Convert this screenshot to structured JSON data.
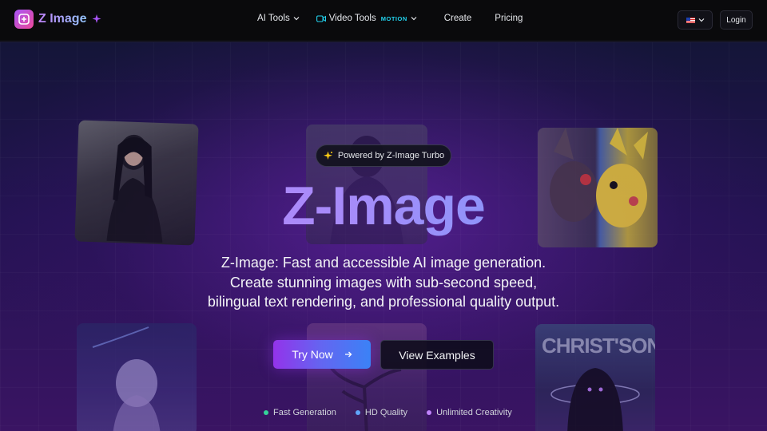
{
  "brand": {
    "name": "Z Image"
  },
  "nav": {
    "ai_tools": "AI Tools",
    "video_tools": "Video Tools",
    "motion_badge": "MOTION",
    "create": "Create",
    "pricing": "Pricing",
    "login": "Login"
  },
  "hero": {
    "pill": "Powered by Z-Image Turbo",
    "title": "Z-Image",
    "subtitle_lines": [
      "Z-Image: Fast and accessible AI image generation.",
      "Create stunning images with sub-second speed,",
      "bilingual text rendering, and professional quality output."
    ],
    "try_label": "Try Now",
    "view_label": "View Examples"
  },
  "features": [
    {
      "label": "Fast Generation",
      "color": "#34d399"
    },
    {
      "label": "HD Quality",
      "color": "#60a5fa"
    },
    {
      "label": "Unlimited Creativity",
      "color": "#c084fc"
    }
  ],
  "gallery": {
    "card_text": "CHRIST'SON"
  },
  "colors": {
    "accent_purple": "#9333ea",
    "accent_blue": "#3b82f6",
    "bg": "#0d0b1e"
  }
}
